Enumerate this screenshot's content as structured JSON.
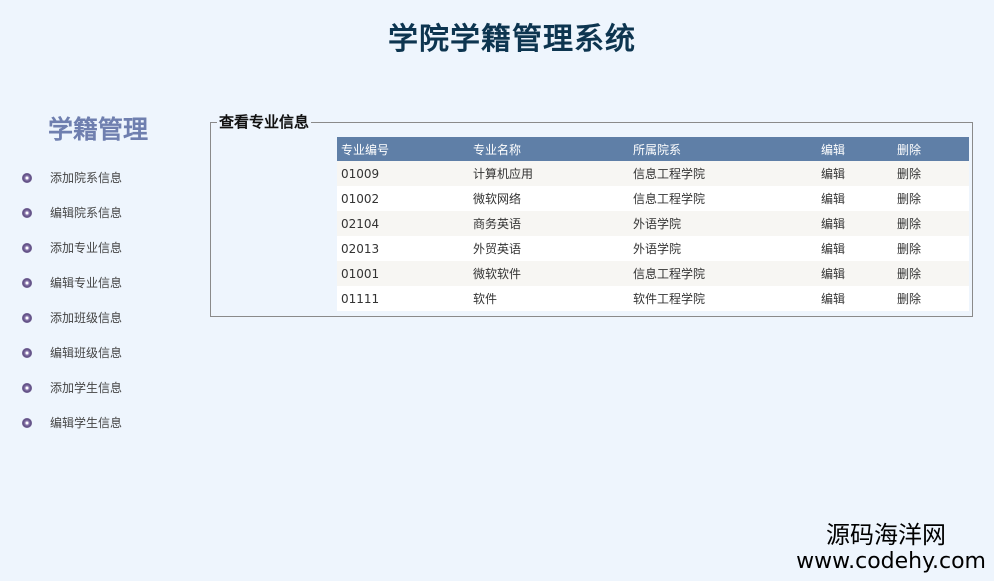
{
  "header": {
    "title": "学院学籍管理系统"
  },
  "sidebar": {
    "title": "学籍管理",
    "items": [
      {
        "label": "添加院系信息"
      },
      {
        "label": "编辑院系信息"
      },
      {
        "label": "添加专业信息"
      },
      {
        "label": "编辑专业信息"
      },
      {
        "label": "添加班级信息"
      },
      {
        "label": "编辑班级信息"
      },
      {
        "label": "添加学生信息"
      },
      {
        "label": "编辑学生信息"
      }
    ],
    "bullet_icon": "spiral-bullet-icon"
  },
  "panel": {
    "legend": "查看专业信息"
  },
  "table": {
    "headers": [
      "专业编号",
      "专业名称",
      "所属院系",
      "编辑",
      "删除"
    ],
    "rows": [
      {
        "id": "01009",
        "name": "计算机应用",
        "dept": "信息工程学院",
        "edit": "编辑",
        "delete": "删除"
      },
      {
        "id": "01002",
        "name": "微软网络",
        "dept": "信息工程学院",
        "edit": "编辑",
        "delete": "删除"
      },
      {
        "id": "02104",
        "name": "商务英语",
        "dept": "外语学院",
        "edit": "编辑",
        "delete": "删除"
      },
      {
        "id": "02013",
        "name": "外贸英语",
        "dept": "外语学院",
        "edit": "编辑",
        "delete": "删除"
      },
      {
        "id": "01001",
        "name": "微软软件",
        "dept": "信息工程学院",
        "edit": "编辑",
        "delete": "删除"
      },
      {
        "id": "01111",
        "name": "软件",
        "dept": "软件工程学院",
        "edit": "编辑",
        "delete": "删除"
      }
    ]
  },
  "watermark": {
    "name": "源码海洋网",
    "url": "www.codehy.com"
  },
  "colors": {
    "background": "#eef5fd",
    "title": "#0d3550",
    "sidebar_title": "#6f7faf",
    "table_header": "#5f7fa7",
    "row_alt": "#f7f6f3"
  }
}
